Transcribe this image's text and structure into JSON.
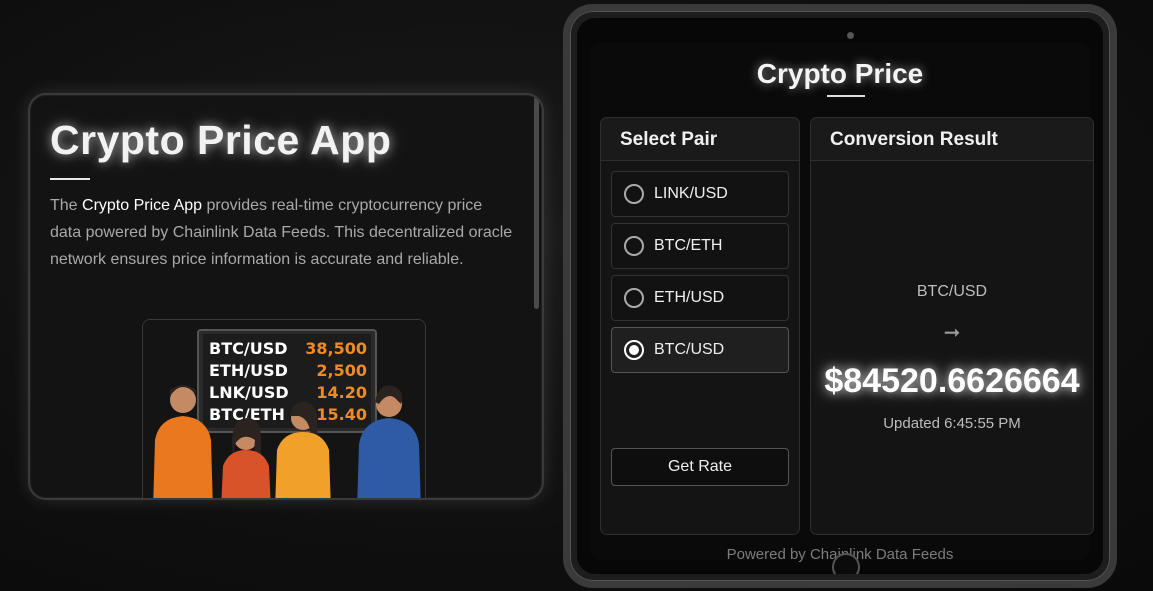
{
  "info": {
    "title": "Crypto Price App",
    "desc_prefix": "The ",
    "desc_highlight": "Crypto Price App",
    "desc_rest": " provides real-time cryptocurrency price data powered by Chainlink Data Feeds. This decentralized oracle network ensures price information is accurate and reliable."
  },
  "illustration": {
    "board": [
      {
        "pair": "BTC/USD",
        "price": "38,500"
      },
      {
        "pair": "ETH/USD",
        "price": "2,500"
      },
      {
        "pair": "LNK/USD",
        "price": "14.20"
      },
      {
        "pair": "BTC/ETH",
        "price": "15.40"
      }
    ]
  },
  "app": {
    "title": "Crypto Price",
    "select_header": "Select Pair",
    "result_header": "Conversion Result",
    "pairs": [
      {
        "label": "LINK/USD",
        "selected": false
      },
      {
        "label": "BTC/ETH",
        "selected": false
      },
      {
        "label": "ETH/USD",
        "selected": false
      },
      {
        "label": "BTC/USD",
        "selected": true
      }
    ],
    "get_rate_label": "Get Rate",
    "result": {
      "pair": "BTC/USD",
      "arrow": "➞",
      "value": "$84520.6626664",
      "updated": "Updated 6:45:55 PM"
    },
    "footer": "Powered by Chainlink Data Feeds"
  },
  "colors": {
    "background": "#0f0f0f",
    "board_price": "#f08a24",
    "board_text": "#ffffff"
  }
}
